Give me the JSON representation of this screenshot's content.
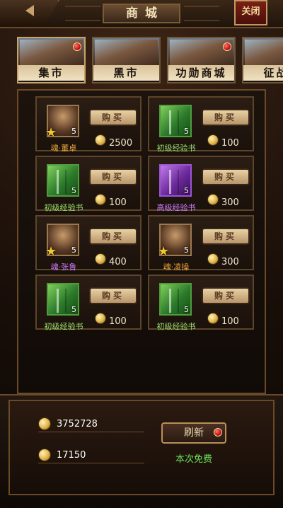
{
  "topbar": {
    "title": "商城",
    "close_label": "关闭"
  },
  "tabs": [
    {
      "label": "集市",
      "has_badge": true
    },
    {
      "label": "黑市",
      "has_badge": false
    },
    {
      "label": "功勋商城",
      "has_badge": true
    },
    {
      "label": "征战",
      "has_badge": false
    }
  ],
  "shop": {
    "buy_label": "购买",
    "items": [
      {
        "name": "魂·董卓",
        "count": "5",
        "price": "2500",
        "icon": "portrait-icon",
        "name_color": "#f0a63a",
        "icon_style": "portrait"
      },
      {
        "name": "初级经验书",
        "count": "5",
        "price": "100",
        "icon": "green-book-icon",
        "name_color": "#9be36c",
        "icon_style": "green"
      },
      {
        "name": "初级经验书",
        "count": "5",
        "price": "100",
        "icon": "green-book-icon",
        "name_color": "#9be36c",
        "icon_style": "green"
      },
      {
        "name": "高级经验书",
        "count": "5",
        "price": "300",
        "icon": "purple-book-icon",
        "name_color": "#cf7bff",
        "icon_style": "purple"
      },
      {
        "name": "魂·张鲁",
        "count": "5",
        "price": "400",
        "icon": "portrait-icon",
        "name_color": "#cf7bff",
        "icon_style": "portrait"
      },
      {
        "name": "魂·凌操",
        "count": "5",
        "price": "300",
        "icon": "portrait-icon",
        "name_color": "#f0a63a",
        "icon_style": "portrait"
      },
      {
        "name": "初级经验书",
        "count": "5",
        "price": "100",
        "icon": "green-book-icon",
        "name_color": "#9be36c",
        "icon_style": "green"
      },
      {
        "name": "初级经验书",
        "count": "5",
        "price": "100",
        "icon": "green-book-icon",
        "name_color": "#9be36c",
        "icon_style": "green"
      }
    ]
  },
  "footer": {
    "copper": "3752728",
    "gold": "17150",
    "refresh_label": "刷新",
    "free_text": "本次免费"
  },
  "colors": {
    "accent_gold": "#c7a26a",
    "badge_red": "#c01111",
    "free_green": "#6ee35a"
  }
}
